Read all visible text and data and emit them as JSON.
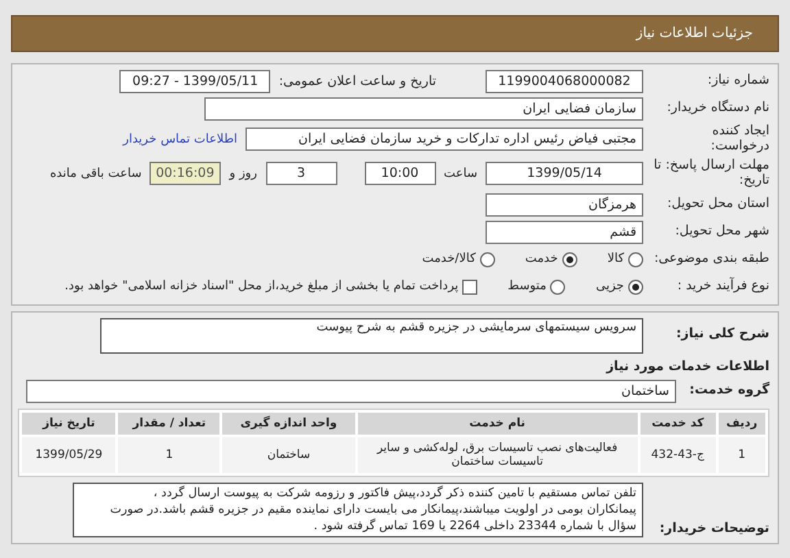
{
  "header": {
    "title": "جزئیات اطلاعات نیاز"
  },
  "need_number": {
    "label": "شماره نیاز:",
    "value": "1199004068000082"
  },
  "announce_date": {
    "label": "تاریخ و ساعت اعلان عمومی:",
    "value": "1399/05/11 - 09:27"
  },
  "buyer_org": {
    "label": "نام دستگاه خریدار:",
    "value": "سازمان فضایی ایران"
  },
  "creator": {
    "label": "ایجاد کننده درخواست:",
    "value": "مجتبی  فیاض رئیس اداره تدارکات و خرید سازمان فضایی ایران",
    "link": "اطلاعات تماس خریدار"
  },
  "deadline": {
    "label": "مهلت ارسال پاسخ: تا تاریخ:",
    "date": "1399/05/14",
    "time_label": "ساعت",
    "time": "10:00",
    "days": "3",
    "days_label": "روز و",
    "remaining": "00:16:09",
    "remaining_label": "ساعت باقی مانده"
  },
  "province": {
    "label": "استان محل تحویل:",
    "value": "هرمزگان"
  },
  "city": {
    "label": "شهر محل تحویل:",
    "value": "قشم"
  },
  "category": {
    "label": "طبقه بندی موضوعی:",
    "options": [
      {
        "label": "کالا",
        "selected": false
      },
      {
        "label": "خدمت",
        "selected": true
      },
      {
        "label": "کالا/خدمت",
        "selected": false
      }
    ]
  },
  "process": {
    "label": "نوع فرآیند خرید :",
    "options": [
      {
        "label": "جزیی",
        "selected": true
      },
      {
        "label": "متوسط",
        "selected": false
      }
    ],
    "payment": {
      "label": "پرداخت تمام یا بخشی از مبلغ خرید،از محل \"اسناد خزانه اسلامی\" خواهد بود.",
      "checked": false
    }
  },
  "description": {
    "label": "شرح کلی نیاز:",
    "value": "سرویس سیستمهای سرمایشی در جزیره قشم به شرح پیوست"
  },
  "services_heading": "اطلاعات خدمات مورد نیاز",
  "service_group": {
    "label": "گروه خدمت:",
    "value": "ساختمان"
  },
  "table": {
    "columns": [
      "ردیف",
      "کد خدمت",
      "نام خدمت",
      "واحد اندازه گیری",
      "تعداد / مقدار",
      "تاریخ نیاز"
    ],
    "rows": [
      [
        "1",
        "ج-43-432",
        "فعالیت‌های نصب تاسیسات برق، لوله‌کشی و سایر تاسیسات ساختمان",
        "ساختمان",
        "1",
        "1399/05/29"
      ]
    ]
  },
  "buyer_notes": {
    "label": "توضیحات خریدار:",
    "lines": [
      "تلفن تماس مستقیم با تامین کننده ذکر گردد،پیش فاکتور و رزومه شرکت به پیوست ارسال گردد ،",
      "پیمانکاران بومی در اولویت میباشند،پیمانکار می بایست دارای نماینده مقیم در جزیره قشم باشد.در صورت",
      "سؤال با شماره 23344 داخلی 2264 یا 169 تماس گرفته شود ."
    ]
  }
}
